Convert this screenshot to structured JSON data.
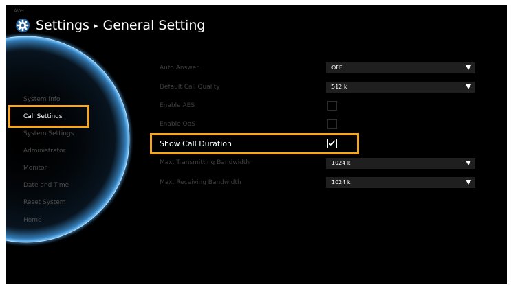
{
  "app": {
    "brand": "AVer"
  },
  "header": {
    "title": "Settings",
    "breadcrumb_separator": "▸",
    "subtitle": "General Setting"
  },
  "sidebar": {
    "items": [
      {
        "label": "System Info",
        "active": false
      },
      {
        "label": "Call Settings",
        "active": true
      },
      {
        "label": "System Settings",
        "active": false
      },
      {
        "label": "Administrator",
        "active": false
      },
      {
        "label": "Monitor",
        "active": false
      },
      {
        "label": "Date and Time",
        "active": false
      },
      {
        "label": "Reset System",
        "active": false
      },
      {
        "label": "Home",
        "active": false
      }
    ]
  },
  "settings": {
    "auto_answer": {
      "label": "Auto Answer",
      "value": "OFF"
    },
    "default_call_quality": {
      "label": "Default Call Quality",
      "value": "512 k"
    },
    "enable_aes": {
      "label": "Enable AES",
      "checked": false
    },
    "enable_qos": {
      "label": "Enable QoS",
      "checked": false
    },
    "show_call_duration": {
      "label": "Show Call Duration",
      "checked": true
    },
    "max_tx_bandwidth": {
      "label": "Max. Transmitting Bandwidth",
      "value": "1024 k"
    },
    "max_rx_bandwidth": {
      "label": "Max. Receiving Bandwidth",
      "value": "1024 k"
    }
  },
  "colors": {
    "background": "#000000",
    "highlight": "#f5a623",
    "glow": "#5fb8ff",
    "active_text": "#ffffff",
    "inactive_text": "#4c4c4c"
  }
}
